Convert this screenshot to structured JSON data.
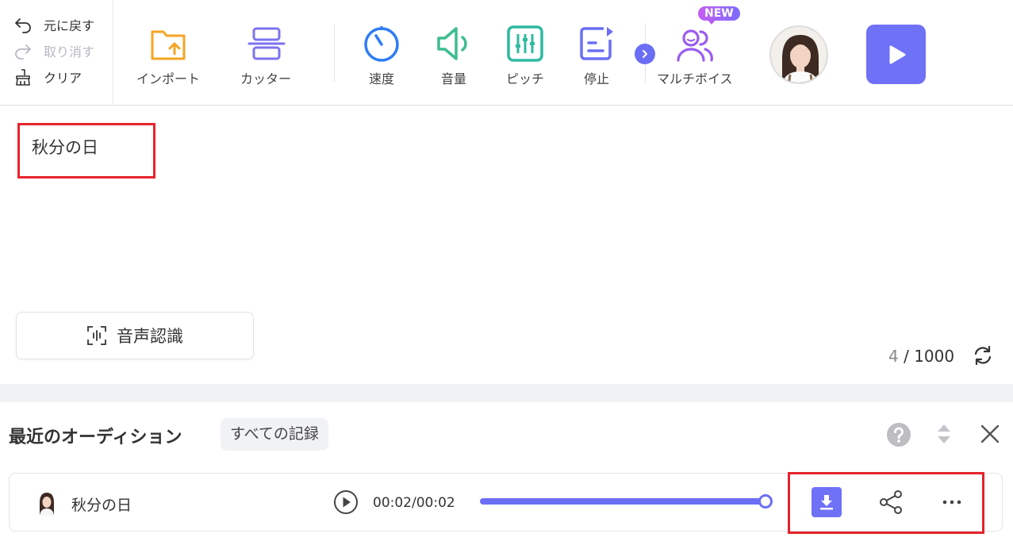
{
  "history": {
    "undo_label": "元に戻す",
    "redo_label": "取り消す",
    "clear_label": "クリア"
  },
  "toolbar": {
    "import_label": "インポート",
    "cutter_label": "カッター",
    "speed_label": "速度",
    "volume_label": "音量",
    "pitch_label": "ピッチ",
    "pause_label": "停止",
    "multivoice_label": "マルチボイス",
    "new_badge": "NEW"
  },
  "editor": {
    "text": "秋分の日",
    "asr_label": "音声認識",
    "char_count": "4",
    "char_sep": " / ",
    "char_limit": "1000"
  },
  "panel": {
    "title": "最近のオーディション",
    "all_records_label": "すべての記録",
    "records": [
      {
        "title": "秋分の日",
        "time": "00:02/00:02",
        "progress": 1.0
      }
    ]
  },
  "colors": {
    "accent": "#6b6ef5",
    "highlight": "#e6232b",
    "import": "#f5a623",
    "speed": "#2f7cf6",
    "volume": "#3dbd8d",
    "pitch": "#2fb9a0"
  }
}
